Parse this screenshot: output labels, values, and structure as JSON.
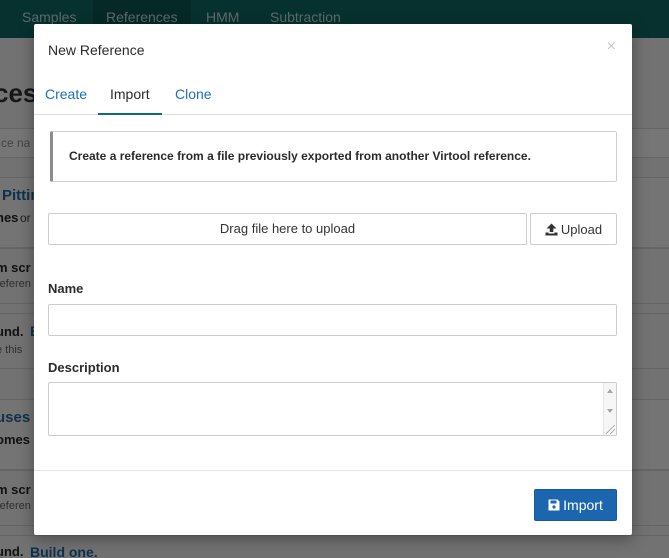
{
  "background": {
    "nav": [
      "Samples",
      "References",
      "HMM",
      "Subtraction"
    ],
    "page_title_fragment": "ces",
    "search_fragment": "ce na",
    "rows": [
      {
        "title": "Pittin",
        "line": "nes",
        "line2": "or"
      },
      {
        "bold": "m scr",
        "small": "referen"
      },
      {
        "bold": "und.",
        "link": "E",
        "small": "e this"
      },
      {
        "title": "uses",
        "line": "omes"
      },
      {
        "bold": "m scr",
        "small": "referen"
      },
      {
        "bold": "und.",
        "link": "Build one."
      }
    ]
  },
  "modal": {
    "title": "New Reference",
    "close_symbol": "×",
    "tabs": [
      {
        "label": "Create",
        "active": false
      },
      {
        "label": "Import",
        "active": true
      },
      {
        "label": "Clone",
        "active": false
      }
    ],
    "alert": "Create a reference from a file previously exported from another Virtool reference.",
    "dropzone": "Drag file here to upload",
    "upload_button": {
      "label": "Upload",
      "icon": "upload-icon"
    },
    "fields": {
      "name": {
        "label": "Name",
        "value": ""
      },
      "description": {
        "label": "Description",
        "value": ""
      }
    },
    "import_button": {
      "label": "Import",
      "icon": "save-icon"
    }
  },
  "colors": {
    "nav_bg": "#0e5a56",
    "primary_button": "#1b66ae",
    "tab_link": "#1f6fb2",
    "tab_active_underline": "#0e6f6a"
  }
}
